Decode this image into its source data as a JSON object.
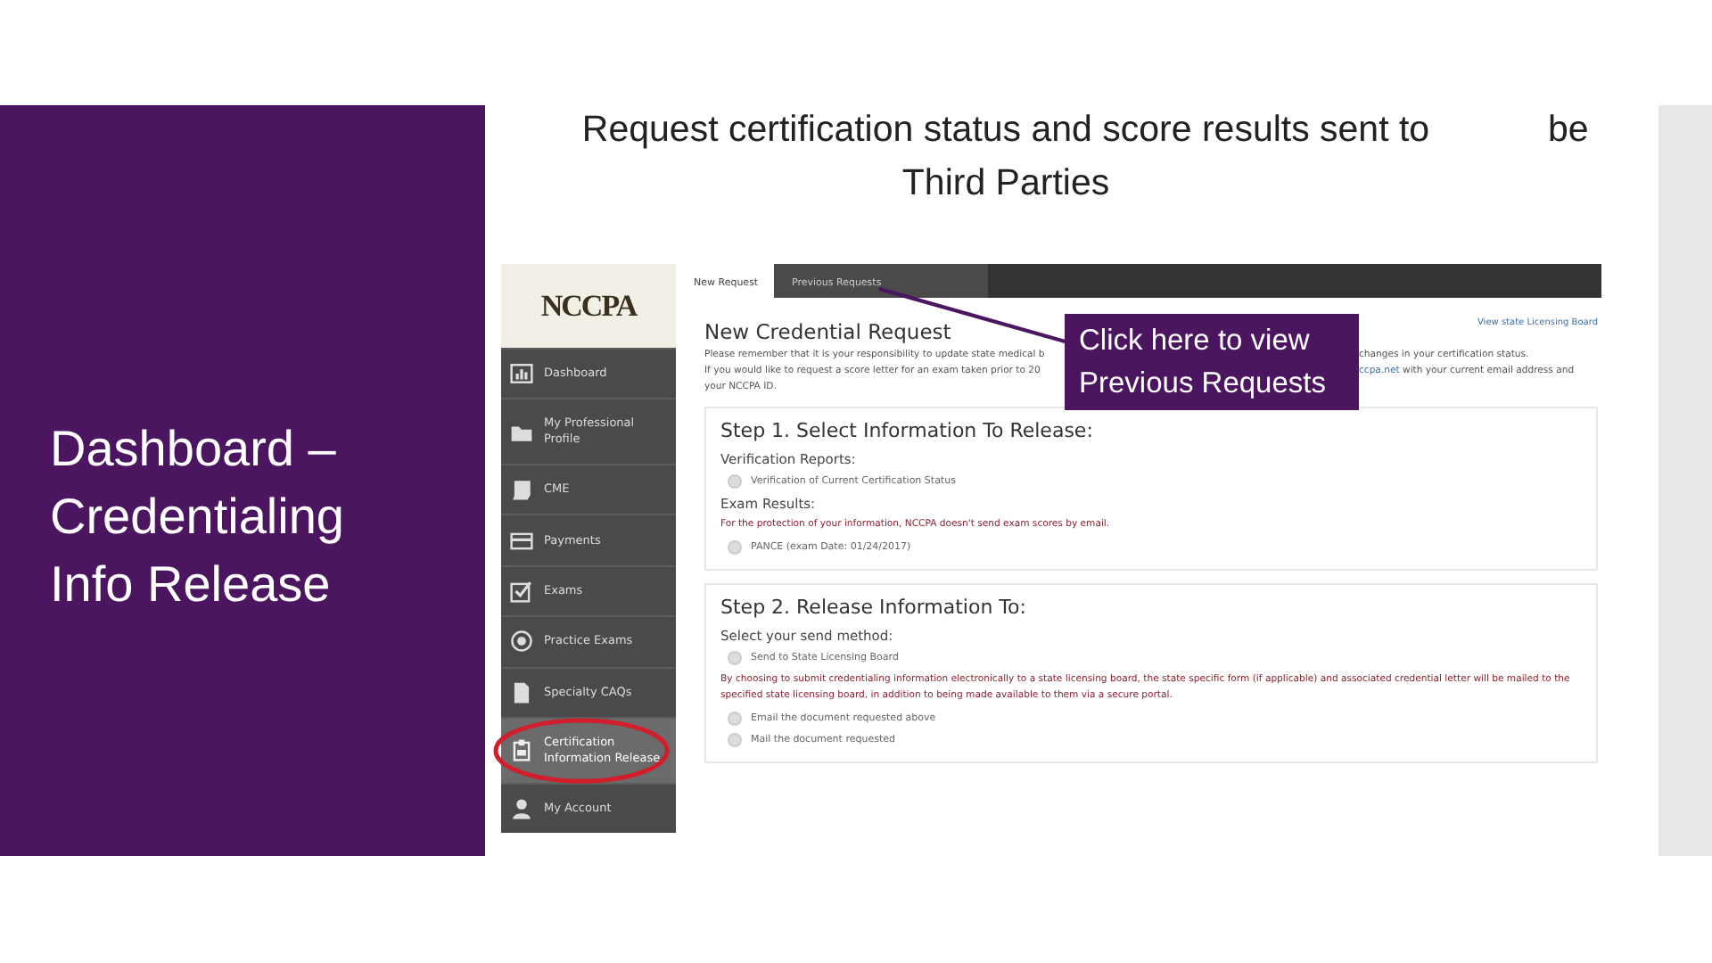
{
  "slide": {
    "title": "Request certification status and score results sent to Third Parties",
    "title_fragment": "be",
    "side_heading": "Dashboard – Credentialing Info Release"
  },
  "app": {
    "logo": "NCCPA",
    "sidebar": [
      {
        "label": "Dashboard",
        "selected": false
      },
      {
        "label": "My Professional Profile",
        "selected": false
      },
      {
        "label": "CME",
        "selected": false
      },
      {
        "label": "Payments",
        "selected": false
      },
      {
        "label": "Exams",
        "selected": false
      },
      {
        "label": "Practice Exams",
        "selected": false
      },
      {
        "label": "Specialty CAQs",
        "selected": false
      },
      {
        "label": "Certification Information Release",
        "selected": true
      },
      {
        "label": "My Account",
        "selected": false
      }
    ],
    "tabs": [
      {
        "label": "New Request",
        "selected": true
      },
      {
        "label": "Previous Requests",
        "selected": false
      }
    ],
    "heading": "New Credential Request",
    "link": "View state Licensing Board",
    "notice_lines": [
      {
        "left": "Please remember that it is your responsibility to update state medical b",
        "right": "changes in your certification status."
      },
      {
        "left": "If you would like to request a score letter for an exam taken prior to 20",
        "right_link": "ccpa.net",
        "right": " with your current email address and"
      },
      {
        "left": "your NCCPA ID."
      }
    ],
    "steps": [
      {
        "title": "Step 1. Select Information To Release:",
        "items": [
          {
            "kind": "label",
            "text": "Verification Reports:"
          },
          {
            "kind": "radio",
            "text": "Verification of Current Certification Status",
            "checked": false
          },
          {
            "kind": "label",
            "text": "Exam Results:"
          },
          {
            "kind": "note",
            "text": "For the protection of your information, NCCPA doesn't send exam scores by email."
          },
          {
            "kind": "radio",
            "text": "PANCE (exam Date: 01/24/2017)",
            "checked": false
          }
        ]
      },
      {
        "title": "Step 2. Release Information To:",
        "items": [
          {
            "kind": "label",
            "text": "Select your send method:"
          },
          {
            "kind": "radio",
            "text": "Send to State Licensing Board",
            "checked": false
          },
          {
            "kind": "note",
            "text": "By choosing to submit credentialing information electronically to a state licensing board, the state specific form (if applicable) and associated credential letter will be mailed to the specified state licensing board, in addition to being made available to them via a secure portal."
          },
          {
            "kind": "radio",
            "text": "Email the document requested above",
            "checked": false
          },
          {
            "kind": "radio",
            "text": "Mail the document requested",
            "checked": false
          }
        ]
      }
    ],
    "callout": "Click here to view Previous Requests"
  }
}
